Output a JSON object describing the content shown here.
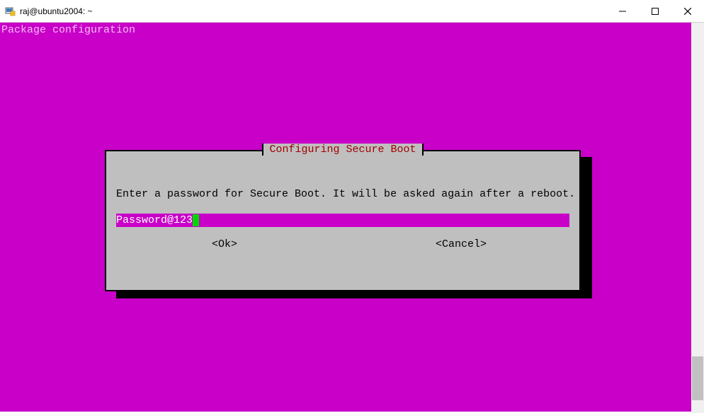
{
  "window": {
    "title": "raj@ubuntu2004: ~"
  },
  "terminal": {
    "header": "Package configuration"
  },
  "dialog": {
    "title": " Configuring Secure Boot ",
    "prompt": "Enter a password for Secure Boot. It will be asked again after a reboot.",
    "password_value": "Password@123",
    "ok_label": "<Ok>",
    "cancel_label": "<Cancel>"
  }
}
